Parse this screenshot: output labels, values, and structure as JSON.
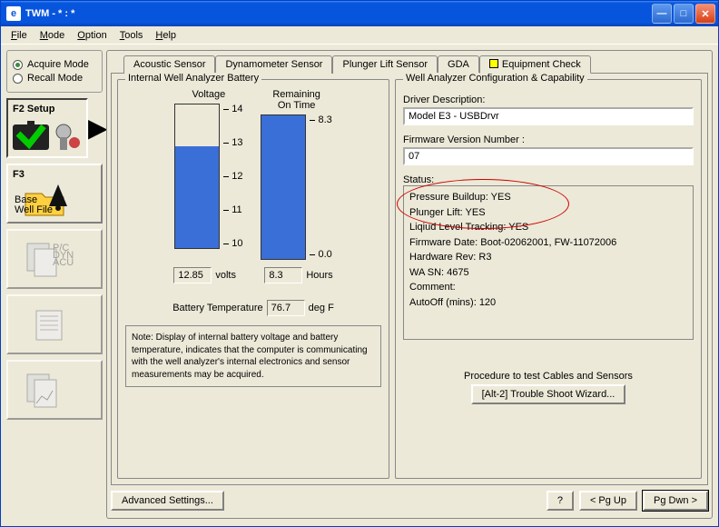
{
  "window": {
    "title": "TWM  -  * : *"
  },
  "menu": {
    "file": "File",
    "mode": "Mode",
    "option": "Option",
    "tools": "Tools",
    "help": "Help"
  },
  "modes": {
    "acquire": "Acquire Mode",
    "recall": "Recall Mode"
  },
  "nav": {
    "f2": "F2 Setup",
    "f3": "F3",
    "f3sub1": "Base",
    "f3sub2": "Well File"
  },
  "tabs": {
    "acoustic": "Acoustic Sensor",
    "dyna": "Dynamometer Sensor",
    "plunger": "Plunger Lift Sensor",
    "gda": "GDA",
    "equip": "Equipment Check"
  },
  "battery": {
    "group": "Internal Well Analyzer Battery",
    "voltage_lbl": "Voltage",
    "remaining_lbl": "Remaining\nOn Time",
    "v_ticks": [
      "14",
      "13",
      "12",
      "11",
      "10"
    ],
    "t_ticks": [
      "8.3",
      "0.0"
    ],
    "voltage_val": "12.85",
    "volts": "volts",
    "time_val": "8.3",
    "hours": "Hours",
    "temp_lbl": "Battery Temperature",
    "temp_val": "76.7",
    "temp_unit": "deg F",
    "note": "Note:  Display of internal battery voltage and battery temperature, indicates that the computer is communicating with the well analyzer's internal electronics and sensor measurements may be acquired."
  },
  "config": {
    "group": "Well Analyzer Configuration & Capability",
    "driver_lbl": "Driver Description:",
    "driver_val": "Model E3 - USBDrvr",
    "fw_lbl": "Firmware Version Number :",
    "fw_val": "07",
    "status_lbl": "Status:",
    "status_lines": [
      "Pressure Buildup: YES",
      "Plunger Lift: YES",
      "Liqiud Level Tracking: YES",
      "Firmware Date: Boot-02062001, FW-11072006",
      "Hardware Rev: R3",
      "WA SN: 4675",
      "Comment:",
      "AutoOff (mins): 120"
    ],
    "proc_lbl": "Procedure to test Cables and Sensors",
    "ts_btn": "[Alt-2]  Trouble Shoot Wizard..."
  },
  "bottom": {
    "adv": "Advanced Settings...",
    "help": "?",
    "pgup": "< Pg Up",
    "pgdn": "Pg Dwn >"
  },
  "chart_data": [
    {
      "type": "bar",
      "title": "Voltage",
      "categories": [
        "Voltage"
      ],
      "values": [
        12.85
      ],
      "ylim": [
        10,
        14
      ],
      "ylabel": "volts"
    },
    {
      "type": "bar",
      "title": "Remaining On Time",
      "categories": [
        "Time"
      ],
      "values": [
        8.3
      ],
      "ylim": [
        0,
        8.3
      ],
      "ylabel": "Hours"
    }
  ]
}
